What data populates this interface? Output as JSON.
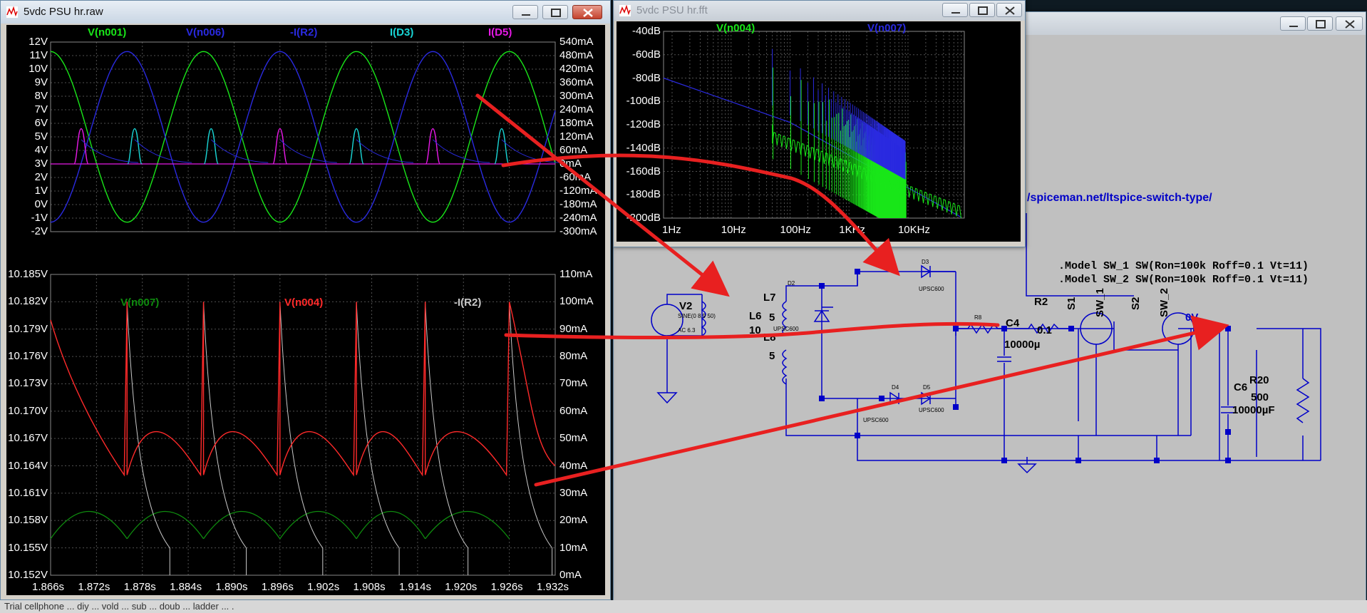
{
  "colors": {
    "green": "#19e619",
    "blue": "#2a2ae0",
    "magenta": "#e619e6",
    "cyan": "#19d4d4",
    "red": "#ff2a2a",
    "gray": "#c8c8c8",
    "darkgreen": "#0e8a0e",
    "wire": "#0000c8",
    "arrow": "#e82020"
  },
  "waveform_window": {
    "title": "5vdc  PSU hr.raw",
    "top_traces": [
      {
        "label": "V(n001)",
        "color": "#19e619"
      },
      {
        "label": "V(n006)",
        "color": "#2a2ae0"
      },
      {
        "label": "-I(R2)",
        "color": "#2a2ae0"
      },
      {
        "label": "I(D3)",
        "color": "#19d4d4"
      },
      {
        "label": "I(D5)",
        "color": "#e619e6"
      }
    ],
    "top_left_ticks": [
      "12V",
      "11V",
      "10V",
      "9V",
      "8V",
      "7V",
      "6V",
      "5V",
      "4V",
      "3V",
      "2V",
      "1V",
      "0V",
      "-1V",
      "-2V"
    ],
    "top_right_ticks": [
      "540mA",
      "480mA",
      "420mA",
      "360mA",
      "300mA",
      "240mA",
      "180mA",
      "120mA",
      "60mA",
      "0mA",
      "-60mA",
      "-120mA",
      "-180mA",
      "-240mA",
      "-300mA"
    ],
    "bottom_traces": [
      {
        "label": "V(n007)",
        "color": "#0e8a0e"
      },
      {
        "label": "V(n004)",
        "color": "#ff2a2a"
      },
      {
        "label": "-I(R2)",
        "color": "#c8c8c8"
      }
    ],
    "bottom_left_ticks": [
      "10.185V",
      "10.182V",
      "10.179V",
      "10.176V",
      "10.173V",
      "10.170V",
      "10.167V",
      "10.164V",
      "10.161V",
      "10.158V",
      "10.155V",
      "10.152V"
    ],
    "bottom_right_ticks": [
      "110mA",
      "100mA",
      "90mA",
      "80mA",
      "70mA",
      "60mA",
      "50mA",
      "40mA",
      "30mA",
      "20mA",
      "10mA",
      "0mA"
    ],
    "x_ticks": [
      "1.866s",
      "1.872s",
      "1.878s",
      "1.884s",
      "1.890s",
      "1.896s",
      "1.902s",
      "1.908s",
      "1.914s",
      "1.920s",
      "1.926s",
      "1.932s"
    ]
  },
  "fft_window": {
    "title": "5vdc  PSU hr.fft",
    "traces": [
      {
        "label": "V(n004)",
        "color": "#19e619"
      },
      {
        "label": "V(n007)",
        "color": "#2a2ae0"
      }
    ],
    "y_ticks": [
      "-40dB",
      "-60dB",
      "-80dB",
      "-100dB",
      "-120dB",
      "-140dB",
      "-160dB",
      "-180dB",
      "-200dB"
    ],
    "x_ticks": [
      "1Hz",
      "10Hz",
      "100Hz",
      "1KHz",
      "10KHz"
    ]
  },
  "schematic_window": {
    "link_text": "/spiceman.net/ltspice-switch-type/",
    "models": [
      ".Model SW_1 SW(Ron=100k Roff=0.1 Vt=11)",
      ".Model SW_2 SW(Ron=100k Roff=0.1 Vt=11)"
    ],
    "labels": {
      "v2": "V2",
      "v2_sine": "SINE(0 8.9 50)",
      "v2_ac": "AC 6.3",
      "l6": "L6",
      "l6_val": "10",
      "l7": "L7",
      "l7_val": "5",
      "l8": "L8",
      "l8_val": "5",
      "d2": "D2",
      "d3": "D3",
      "d4": "D4",
      "d5": "D5",
      "diode_model": "UPSC600",
      "r8": "R8",
      "c4": "C4",
      "c4_val": "10000µ",
      "r2": "R2",
      "r2_val": "0.1",
      "s1": "S1",
      "sw1": "SW_1",
      "s2": "S2",
      "sw2": "SW_2",
      "node": "0V",
      "c6": "C6",
      "c6_val": "10000µF",
      "r20": "R20",
      "r20_val": "500"
    }
  },
  "taskbar_text": "Trial cellphone ... diy ... vold ... sub ... doub ... ladder ... .",
  "chart_data": [
    {
      "type": "line",
      "title": "",
      "xlabel": "",
      "ylabel": "",
      "x_range": [
        1.866,
        1.932
      ],
      "ylim": [
        -2,
        12
      ],
      "y2lim": [
        -0.3,
        0.54
      ],
      "series": [
        {
          "name": "V(n001)",
          "description": "sine",
          "amplitude": 6.3,
          "offset": 5,
          "freq_hz": 50
        },
        {
          "name": "V(n006)",
          "description": "sine, opposite phase",
          "amplitude": 6.3,
          "offset": 5,
          "freq_hz": 50
        },
        {
          "name": "I(D3)",
          "peak_ma": 120,
          "pulses_at": [
            1.877,
            1.887,
            1.906,
            1.925
          ]
        },
        {
          "name": "I(D5)",
          "peak_ma": 120,
          "pulses_at": [
            1.87,
            1.896,
            1.916
          ]
        }
      ]
    },
    {
      "type": "line",
      "title": "",
      "x_range": [
        1.866,
        1.932
      ],
      "ylim": [
        10.152,
        10.185
      ],
      "y2lim": [
        0,
        0.11
      ],
      "series": [
        {
          "name": "V(n004)",
          "peak": 10.182,
          "valley": 10.163,
          "peaks_at": [
            1.876,
            1.886,
            1.896,
            1.906,
            1.915,
            1.926
          ]
        },
        {
          "name": "V(n007)",
          "peak": 10.161,
          "valley": 10.155
        },
        {
          "name": "-I(R2)",
          "peak_ma": 100
        }
      ]
    },
    {
      "type": "line",
      "title": "",
      "x_scale": "log",
      "xlim_hz": [
        0.5,
        60000
      ],
      "ylim_db": [
        -200,
        -40
      ],
      "series": [
        {
          "name": "V(n004)"
        },
        {
          "name": "V(n007)"
        }
      ]
    }
  ]
}
